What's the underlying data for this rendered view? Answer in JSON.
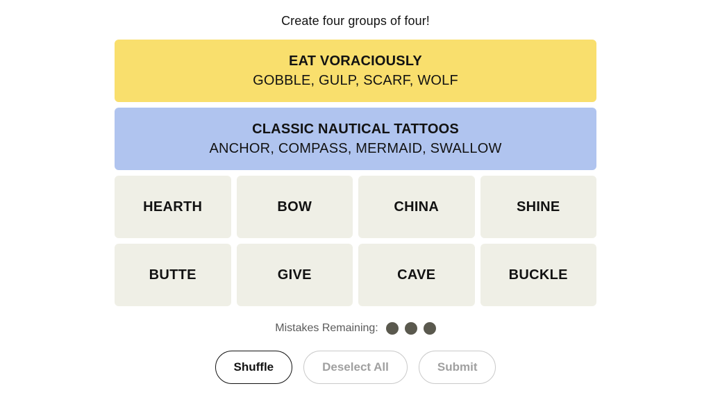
{
  "game": {
    "headline": "Create four groups of four!",
    "solved_groups": [
      {
        "title": "EAT VORACIOUSLY",
        "members": "GOBBLE, GULP, SCARF, WOLF",
        "color": "#f9df6d",
        "difficulty": "yellow"
      },
      {
        "title": "CLASSIC NAUTICAL TATTOOS",
        "members": "ANCHOR, COMPASS, MERMAID, SWALLOW",
        "color": "#b0c4ef",
        "difficulty": "blue"
      }
    ],
    "tile_rows": [
      [
        "HEARTH",
        "BOW",
        "CHINA",
        "SHINE"
      ],
      [
        "BUTTE",
        "GIVE",
        "CAVE",
        "BUCKLE"
      ]
    ],
    "tile_color": "#efefe6",
    "mistakes": {
      "label": "Mistakes Remaining:",
      "remaining": 3,
      "dot_color": "#5a594e"
    },
    "controls": [
      {
        "label": "Shuffle",
        "state": "enabled"
      },
      {
        "label": "Deselect All",
        "state": "disabled"
      },
      {
        "label": "Submit",
        "state": "disabled"
      }
    ]
  }
}
